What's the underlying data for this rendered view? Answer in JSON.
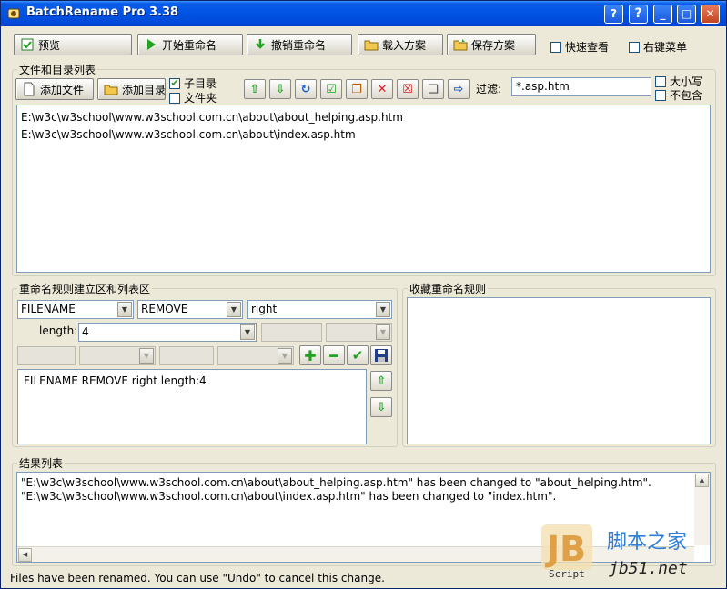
{
  "window": {
    "title": "BatchRename Pro 3.38"
  },
  "toolbar": {
    "preview": "预览",
    "start_rename": "开始重命名",
    "undo_rename": "撤销重命名",
    "load_scheme": "载入方案",
    "save_scheme": "保存方案",
    "quick_view": "快速查看",
    "context_menu": "右键菜单"
  },
  "files": {
    "group_title": "文件和目录列表",
    "add_file": "添加文件",
    "add_folder": "添加目录",
    "subfolder_label": "子目录",
    "subfolder_checked": true,
    "folder_label": "文件夹",
    "folder_checked": false,
    "filter_label": "过滤:",
    "filter_value": "*.asp.htm",
    "case_label": "大小写",
    "exclude_label": "不包含",
    "items": [
      "E:\\w3c\\w3school\\www.w3school.com.cn\\about\\about_helping.asp.htm",
      "E:\\w3c\\w3school\\www.w3school.com.cn\\about\\index.asp.htm"
    ]
  },
  "rules": {
    "group_title": "重命名规则建立区和列表区",
    "target": "FILENAME",
    "action": "REMOVE",
    "position": "right",
    "length_label": "length:",
    "length_value": "4",
    "list": [
      "FILENAME REMOVE right length:4"
    ]
  },
  "favorites": {
    "group_title": "收藏重命名规则"
  },
  "results": {
    "group_title": "结果列表",
    "lines": [
      "\"E:\\w3c\\w3school\\www.w3school.com.cn\\about\\about_helping.asp.htm\"  has been changed to  \"about_helping.htm\".",
      "\"E:\\w3c\\w3school\\www.w3school.com.cn\\about\\index.asp.htm\"  has been changed to  \"index.htm\"."
    ]
  },
  "status": {
    "text": "Files have been renamed. You can use \"Undo\" to cancel this change."
  },
  "watermark": {
    "site_cn": "脚本之家",
    "site_url": "jb51.net",
    "script_label": "Script",
    "logo_text": "JB"
  },
  "colors": {
    "title_bar": "#0054e3",
    "accent_green": "#21a121",
    "delete_red": "#d8202a"
  }
}
